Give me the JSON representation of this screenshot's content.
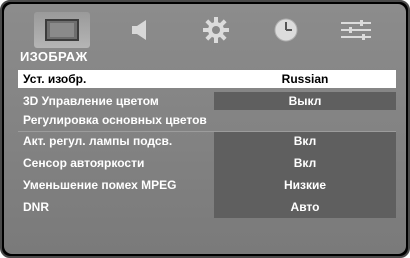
{
  "icons": [
    {
      "name": "picture-tab-icon"
    },
    {
      "name": "sound-tab-icon"
    },
    {
      "name": "settings-tab-icon"
    },
    {
      "name": "timer-tab-icon"
    },
    {
      "name": "options-tab-icon"
    }
  ],
  "section_title": "ИЗОБРАЖ",
  "rows": [
    {
      "label": "Уст. изобр.",
      "value": "Russian"
    },
    {
      "label": "3D Управление цветом",
      "value": "Выкл"
    },
    {
      "label": "Регулировка основных цветов",
      "value": ""
    },
    {
      "label": "Акт. регул. лампы подсв.",
      "value": "Вкл"
    },
    {
      "label": "Сенсор автояркости",
      "value": "Вкл"
    },
    {
      "label": "Уменьшение помех MPEG",
      "value": "Низкие"
    },
    {
      "label": "DNR",
      "value": "Авто"
    }
  ]
}
